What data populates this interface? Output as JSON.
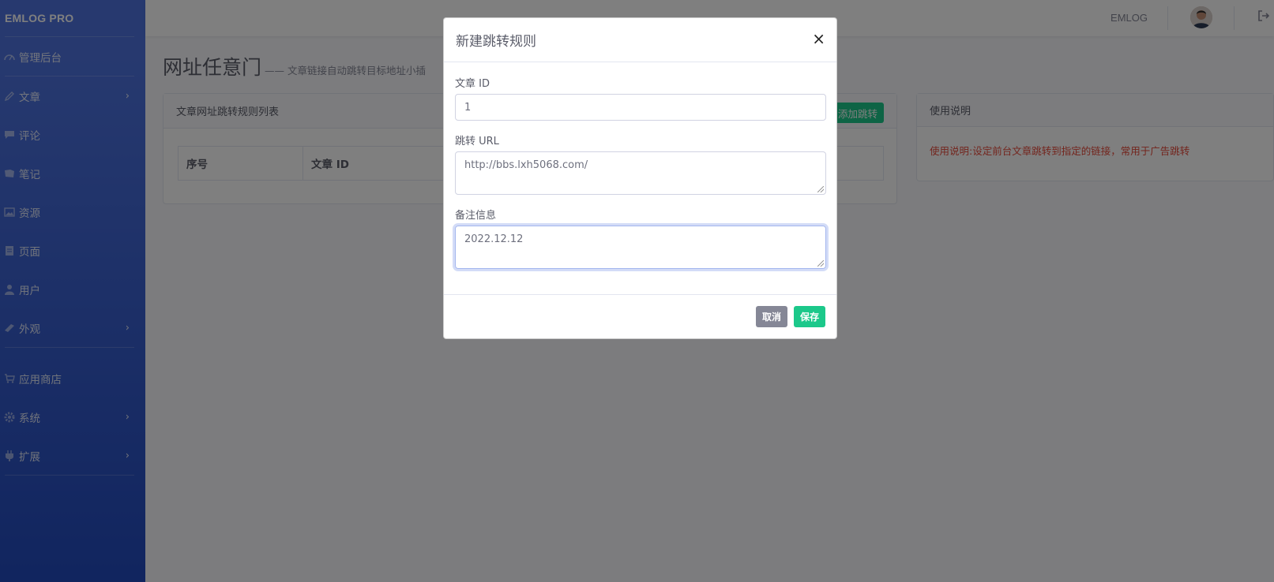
{
  "sidebar": {
    "brand": "EMLOG PRO",
    "items": [
      {
        "label": "管理后台",
        "icon": "dashboard-icon"
      },
      {
        "label": "文章",
        "icon": "pencil-icon",
        "has_children": true
      },
      {
        "label": "评论",
        "icon": "comment-icon"
      },
      {
        "label": "笔记",
        "icon": "note-icon"
      },
      {
        "label": "资源",
        "icon": "image-icon"
      },
      {
        "label": "页面",
        "icon": "page-icon"
      },
      {
        "label": "用户",
        "icon": "user-icon"
      },
      {
        "label": "外观",
        "icon": "palette-icon",
        "has_children": true
      }
    ],
    "items2": [
      {
        "label": "应用商店",
        "icon": "cart-icon"
      },
      {
        "label": "系统",
        "icon": "gear-icon",
        "has_children": true
      },
      {
        "label": "扩展",
        "icon": "plug-icon",
        "has_children": true
      }
    ]
  },
  "topbar": {
    "user_name": "EMLOG",
    "avatar_icon": "avatar-icon",
    "logout_icon": "logout-icon"
  },
  "main": {
    "title": "网址任意门",
    "subtitle": "—— 文章链接自动跳转目标地址小插",
    "list_card": {
      "title": "文章网址跳转规则列表",
      "add_button": "添加跳转",
      "columns": [
        "序号",
        "文章 ID"
      ]
    },
    "usage_card": {
      "title": "使用说明",
      "text": "使用说明:设定前台文章跳转到指定的链接，常用于广告跳转"
    }
  },
  "modal": {
    "title": "新建跳转规则",
    "close": "×",
    "fields": [
      {
        "label": "文章 ID",
        "value": "1"
      },
      {
        "label": "跳转 URL",
        "value": "http://bbs.lxh5068.com/"
      },
      {
        "label": "备注信息",
        "value": "2022.12.12"
      }
    ],
    "cancel": "取消",
    "save": "保存"
  },
  "colors": {
    "sidebar_top": "#4e73df",
    "sidebar_bottom": "#224abe",
    "success": "#1cc88a",
    "secondary": "#858796",
    "danger": "#e74a3b"
  }
}
